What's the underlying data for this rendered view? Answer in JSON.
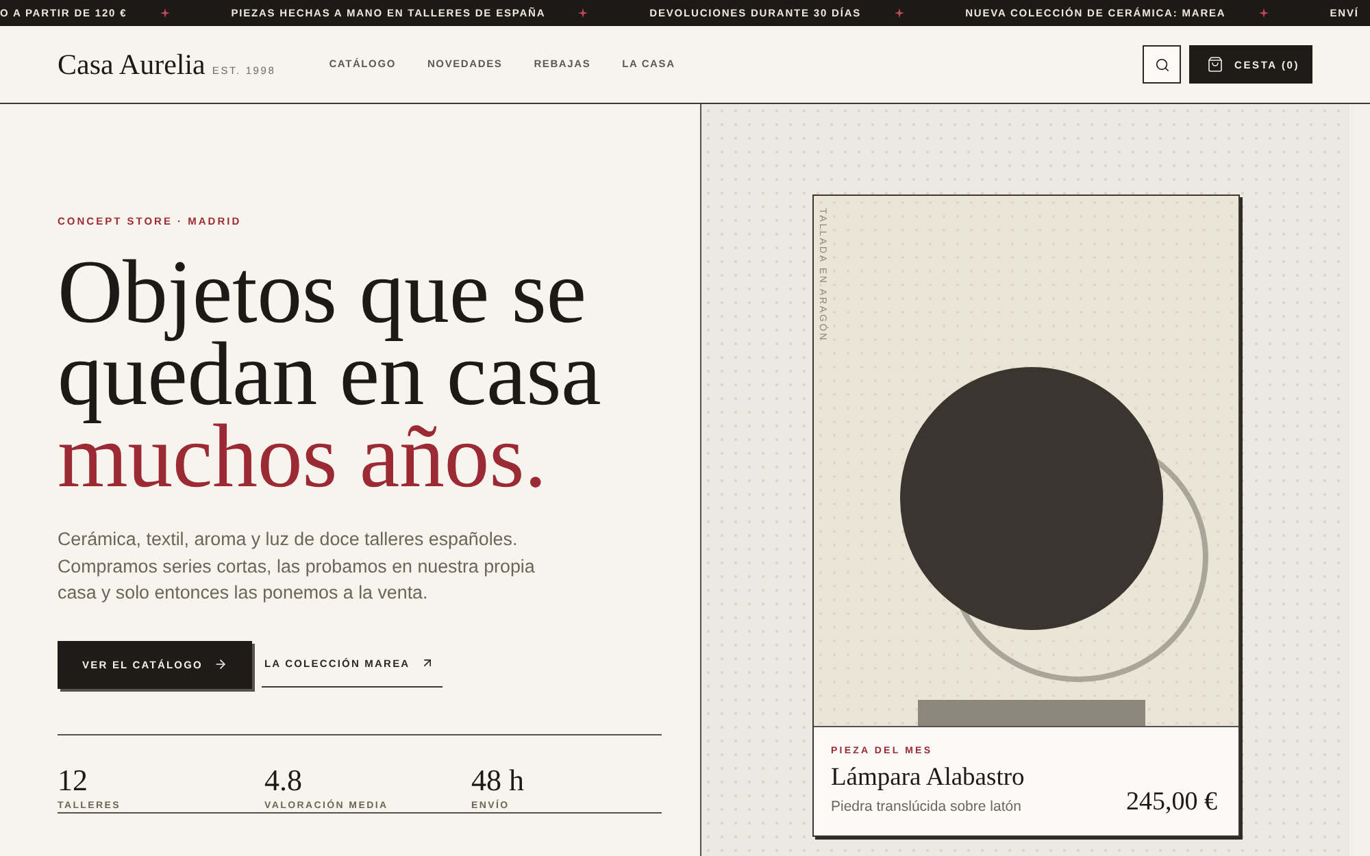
{
  "ticker": [
    "O A PARTIR DE 120 €",
    "PIEZAS HECHAS A MANO EN TALLERES DE ESPAÑA",
    "DEVOLUCIONES DURANTE 30 DÍAS",
    "NUEVA COLECCIÓN DE CERÁMICA: MAREA",
    "ENVÍ"
  ],
  "header": {
    "logo": "Casa Aurelia",
    "established": "EST. 1998",
    "nav": [
      "CATÁLOGO",
      "NOVEDADES",
      "REBAJAS",
      "LA CASA"
    ],
    "cart": "CESTA (0)"
  },
  "hero": {
    "eyebrow": "CONCEPT STORE · MADRID",
    "headline": [
      "Objetos que se",
      "quedan en casa"
    ],
    "headline_accent": "muchos años.",
    "body": "Cerámica, textil, aroma y luz de doce talleres españoles. Compramos series cortas, las probamos en nuestra propia casa y solo entonces las ponemos a la venta.",
    "primary_button": "VER EL CATÁLOGO",
    "secondary_link": "LA COLECCIÓN MAREA",
    "stats": [
      {
        "value": "12",
        "label": "TALLERES"
      },
      {
        "value": "4.8",
        "label": "VALORACIÓN MEDIA"
      },
      {
        "value": "48 h",
        "label": "ENVÍO"
      }
    ]
  },
  "feature": {
    "caption": "TALLADA EN ARAGÓN",
    "eyebrow": "PIEZA DEL MES",
    "name": "Lámpara Alabastro",
    "description": "Piedra translúcida sobre latón",
    "price": "245,00 €"
  }
}
